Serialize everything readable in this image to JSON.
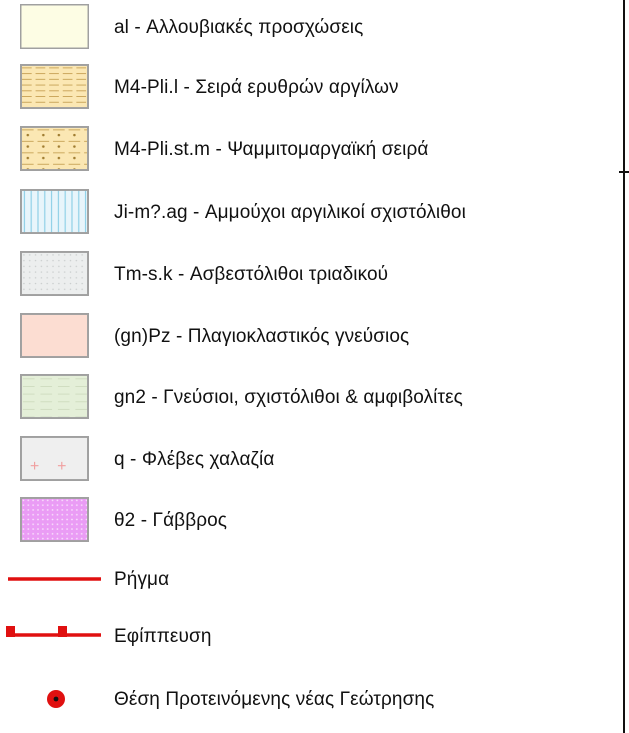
{
  "legend": {
    "items": [
      {
        "label": "al - Αλλουβιακές προσχώσεις",
        "fill": "#fdfde4",
        "pattern": "plain"
      },
      {
        "label": "M4-Pli.l - Σειρά ερυθρών αργίλων",
        "fill": "#fbe7b3",
        "pattern": "dashes"
      },
      {
        "label": "M4-Pli.st.m - Ψαμμιτομαργαϊκή σειρά",
        "fill": "#fbe7b3",
        "pattern": "dashes-dots"
      },
      {
        "label": "Ji-m?.ag - Αμμούχοι αργιλικοί σχιστόλιθοι",
        "fill": "#e8f5fb",
        "pattern": "vlines"
      },
      {
        "label": "Tm-s.k - Ασβεστόλιθοι τριαδικού",
        "fill": "#eceeee",
        "pattern": "grid"
      },
      {
        "label": "(gn)Pz - Πλαγιοκλαστικός γνεύσιος",
        "fill": "#fcddd2",
        "pattern": "plain"
      },
      {
        "label": "gn2 - Γνεύσιοι, σχιστόλιθοι & αμφιβολίτες",
        "fill": "#e4efd8",
        "pattern": "faint-dashes"
      },
      {
        "label": "q - Φλέβες χαλαζία",
        "fill": "#efefef",
        "pattern": "crosses"
      },
      {
        "label": "θ2 - Γάββρος",
        "fill": "#ea9cf5",
        "pattern": "dots"
      },
      {
        "label": "Ρήγμα",
        "symbol": "fault-line",
        "color": "#e01010"
      },
      {
        "label": "Εφίππευση",
        "symbol": "thrust-line",
        "color": "#e01010"
      },
      {
        "label": "Θέση Προτεινόμενης νέας Γεώτρησης",
        "symbol": "borehole-point",
        "color": "#e01010"
      }
    ]
  }
}
